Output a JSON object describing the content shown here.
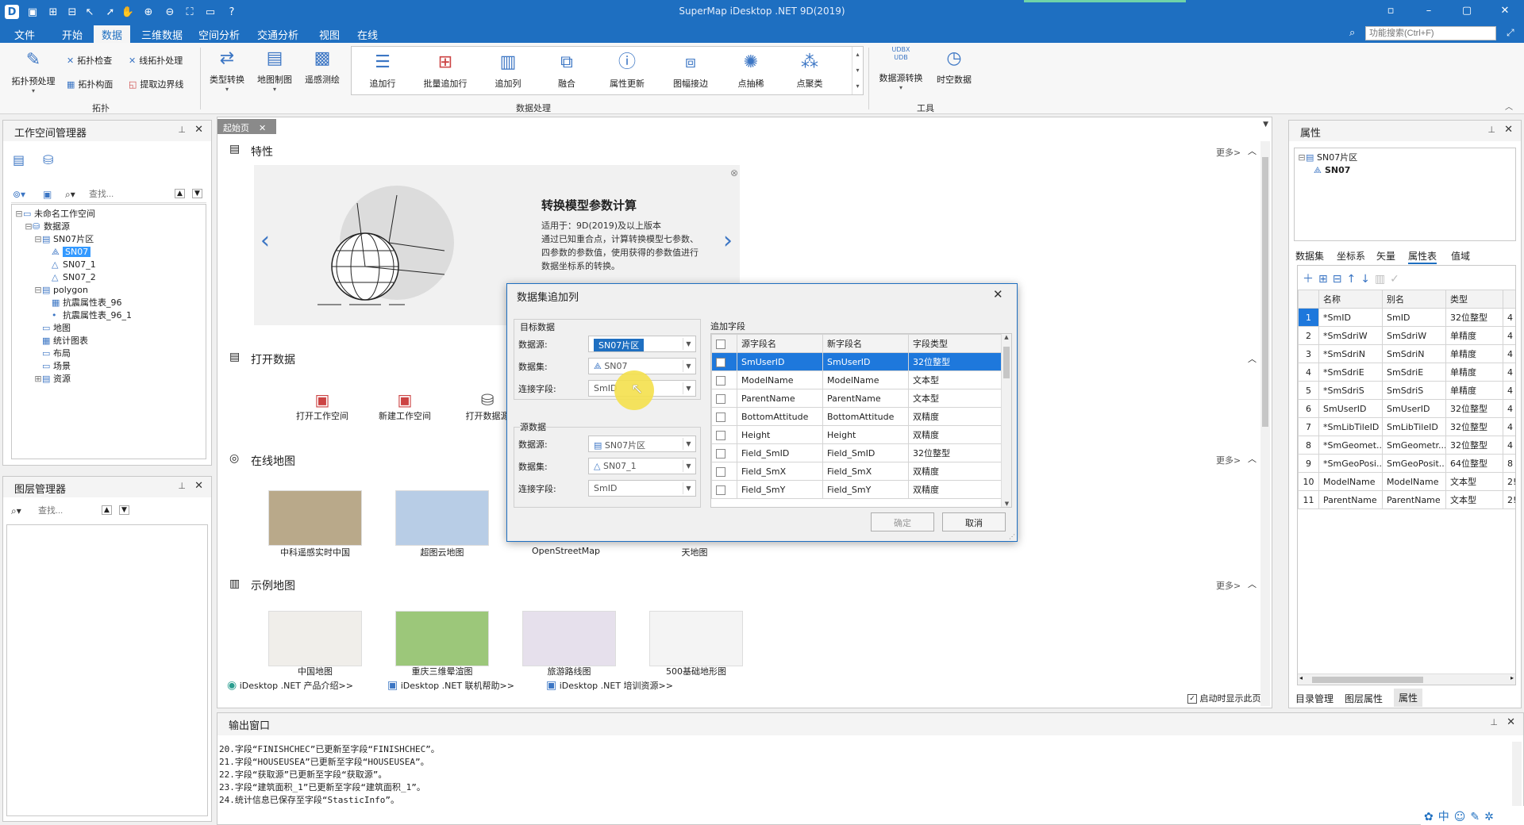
{
  "app": {
    "title": "SuperMap iDesktop .NET 9D(2019)"
  },
  "menu": [
    "文件",
    "开始",
    "数据",
    "三维数据",
    "空间分析",
    "交通分析",
    "视图",
    "在线"
  ],
  "function_search_placeholder": "功能搜索(Ctrl+F)",
  "ribbon": {
    "topology": {
      "group": "拓扑",
      "preprocess": "拓扑预处理",
      "check": "拓扑检查",
      "line_process": "线拓扑处理",
      "build_surface": "拓扑构面",
      "extract_boundary": "提取边界线"
    },
    "convert": [
      "类型转换",
      "地图制图",
      "遥感测绘"
    ],
    "processing": {
      "group": "数据处理",
      "items": [
        "追加行",
        "批量追加行",
        "追加列",
        "融合",
        "属性更新",
        "图幅接边",
        "点抽稀",
        "点聚类"
      ]
    },
    "tools": {
      "group": "工具",
      "udbx_label": "UDBX\nUDB",
      "datasource_convert": "数据源转换",
      "spatiotemporal": "时空数据"
    }
  },
  "workspace_manager": {
    "title": "工作空间管理器",
    "search_placeholder": "查找...",
    "tree": {
      "workspace": "未命名工作空间",
      "datasources": "数据源",
      "ds1": "SN07片区",
      "ds1_items": [
        "SN07",
        "SN07_1",
        "SN07_2"
      ],
      "ds2": "polygon",
      "ds2_items": [
        "抗震属性表_96",
        "抗震属性表_96_1"
      ],
      "others": [
        "地图",
        "统计图表",
        "布局",
        "场景",
        "资源"
      ]
    }
  },
  "layer_manager": {
    "title": "图层管理器",
    "search_placeholder": "查找..."
  },
  "doc": {
    "tab": "起始页",
    "features_title": "特性",
    "feature": {
      "title": "转换模型参数计算",
      "line1": "适用于：9D(2019)及以上版本",
      "line2": "通过已知重合点，计算转换模型七参数、",
      "line3": "四参数的参数值，使用获得的参数值进行",
      "line4": "数据坐标系的转换。"
    },
    "more": "更多>",
    "open_data": {
      "title": "打开数据",
      "items": [
        "打开工作空间",
        "新建工作空间",
        "打开数据源"
      ]
    },
    "online_maps": {
      "title": "在线地图",
      "items": [
        "中科遥感实时中国",
        "超图云地图",
        "OpenStreetMap",
        "天地图"
      ]
    },
    "sample_maps": {
      "title": "示例地图",
      "items": [
        "中国地图",
        "重庆三维晕渲图",
        "旅游路线图",
        "500基础地形图"
      ]
    },
    "footer_links": [
      "iDesktop .NET 产品介绍>>",
      "iDesktop .NET 联机帮助>>",
      "iDesktop .NET 培训资源>>"
    ],
    "show_on_start": "启动时显示此页"
  },
  "dialog": {
    "title": "数据集追加列",
    "target_group": "目标数据",
    "source_group": "源数据",
    "datasource_label": "数据源:",
    "dataset_label": "数据集:",
    "join_field_label": "连接字段:",
    "target": {
      "datasource": "SN07片区",
      "dataset": "SN07",
      "join_field": "SmID"
    },
    "source": {
      "datasource": "SN07片区",
      "dataset": "SN07_1",
      "join_field": "SmID"
    },
    "append_group": "追加字段",
    "columns": [
      "源字段名",
      "新字段名",
      "字段类型"
    ],
    "rows": [
      [
        "SmUserID",
        "SmUserID",
        "32位整型"
      ],
      [
        "ModelName",
        "ModelName",
        "文本型"
      ],
      [
        "ParentName",
        "ParentName",
        "文本型"
      ],
      [
        "BottomAttitude",
        "BottomAttitude",
        "双精度"
      ],
      [
        "Height",
        "Height",
        "双精度"
      ],
      [
        "Field_SmID",
        "Field_SmID",
        "32位整型"
      ],
      [
        "Field_SmX",
        "Field_SmX",
        "双精度"
      ],
      [
        "Field_SmY",
        "Field_SmY",
        "双精度"
      ]
    ],
    "ok": "确定",
    "cancel": "取消"
  },
  "properties": {
    "title": "属性",
    "tree_root": "SN07片区",
    "tree_child": "SN07",
    "tabs": [
      "数据集",
      "坐标系",
      "矢量",
      "属性表",
      "值域"
    ],
    "columns": [
      "名称",
      "别名",
      "类型"
    ],
    "rows": [
      [
        "1",
        "*SmID",
        "SmID",
        "32位整型",
        "4"
      ],
      [
        "2",
        "*SmSdriW",
        "SmSdriW",
        "单精度",
        "4"
      ],
      [
        "3",
        "*SmSdriN",
        "SmSdriN",
        "单精度",
        "4"
      ],
      [
        "4",
        "*SmSdriE",
        "SmSdriE",
        "单精度",
        "4"
      ],
      [
        "5",
        "*SmSdriS",
        "SmSdriS",
        "单精度",
        "4"
      ],
      [
        "6",
        "SmUserID",
        "SmUserID",
        "32位整型",
        "4"
      ],
      [
        "7",
        "*SmLibTileID",
        "SmLibTileID",
        "32位整型",
        "4"
      ],
      [
        "8",
        "*SmGeomet...",
        "SmGeometr...",
        "32位整型",
        "4"
      ],
      [
        "9",
        "*SmGeoPosi...",
        "SmGeoPosit...",
        "64位整型",
        "8"
      ],
      [
        "10",
        "ModelName",
        "ModelName",
        "文本型",
        "2!"
      ],
      [
        "11",
        "ParentName",
        "ParentName",
        "文本型",
        "2!"
      ]
    ],
    "bottom_tabs": [
      "目录管理",
      "图层属性",
      "属性"
    ]
  },
  "output": {
    "title": "输出窗口",
    "lines": [
      "20.字段“FINISHCHEC”已更新至字段“FINISHCHEC”。",
      "21.字段“HOUSEUSEA”已更新至字段“HOUSEUSEA”。",
      "22.字段“获取源”已更新至字段“获取源”。",
      "23.字段“建筑面积_1”已更新至字段“建筑面积_1”。",
      "24.统计信息已保存至字段“StasticInfo”。"
    ]
  },
  "tray": [
    "中"
  ]
}
